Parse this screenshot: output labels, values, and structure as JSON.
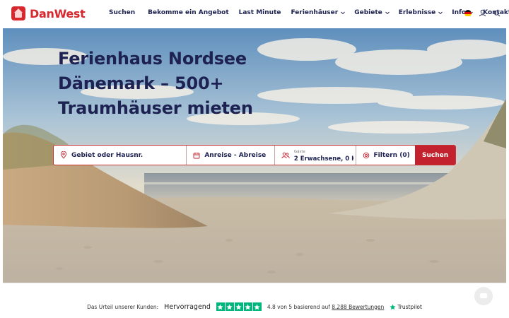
{
  "brand": {
    "name": "DanWest",
    "color": "#d7282f"
  },
  "nav": {
    "items": [
      {
        "label": "Suchen",
        "dropdown": false
      },
      {
        "label": "Bekomme ein Angebot",
        "dropdown": false
      },
      {
        "label": "Last Minute",
        "dropdown": false
      },
      {
        "label": "Ferienhäuser",
        "dropdown": true
      },
      {
        "label": "Gebiete",
        "dropdown": true
      },
      {
        "label": "Erlebnisse",
        "dropdown": true
      },
      {
        "label": "Info",
        "dropdown": true
      },
      {
        "label": "Kontakt",
        "dropdown": false
      }
    ],
    "icons": [
      "german-flag-icon",
      "user-icon",
      "search-icon"
    ]
  },
  "hero": {
    "title": "Ferienhaus Nordsee Dänemark – 500+ Traumhäuser mieten"
  },
  "search": {
    "location_placeholder": "Gebiet oder Hausnr.",
    "dates_label": "Anreise - Abreise",
    "guests_caption": "Gäste",
    "guests_value": "2 Erwachsene, 0 Ki",
    "filter_label": "Filtern (0)",
    "submit_label": "Suchen",
    "accent": "#c3212d"
  },
  "rating": {
    "intro": "Das Urteil unserer Kunden:",
    "word": "Hervorragend",
    "score_text": "4.8 von 5 basierend auf",
    "reviews_link": "8.288 Bewertungen",
    "provider": "Trustpilot",
    "stars": 5,
    "star_color": "#00b67a"
  }
}
